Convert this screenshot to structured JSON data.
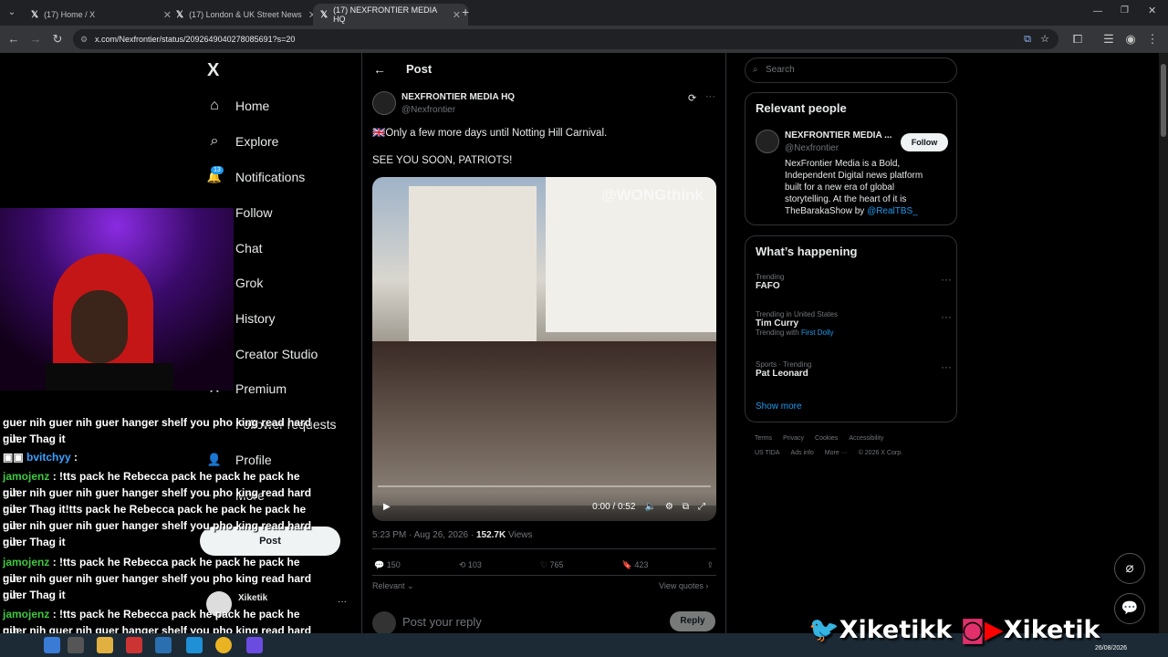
{
  "browser": {
    "tabs": [
      {
        "title": "(17) Home / X",
        "active": false
      },
      {
        "title": "(17) London & UK Street News",
        "active": false
      },
      {
        "title": "(17) NEXFRONTIER MEDIA HQ",
        "active": true
      }
    ],
    "new_tab": "+",
    "url": "x.com/Nexfrontier/status/2092649040278085691?s=20"
  },
  "sidebar": {
    "logo": "X",
    "items": [
      {
        "label": "Home",
        "icon": "home-icon",
        "glyph": "⌂"
      },
      {
        "label": "Explore",
        "icon": "search-icon",
        "glyph": "⌕"
      },
      {
        "label": "Notifications",
        "icon": "bell-icon",
        "glyph": "🔔",
        "badge": "13"
      },
      {
        "label": "Follow",
        "icon": "person-plus-icon",
        "glyph": "👤"
      },
      {
        "label": "Chat",
        "icon": "mail-icon",
        "glyph": "✉"
      },
      {
        "label": "Grok",
        "icon": "grok-icon",
        "glyph": "◪"
      },
      {
        "label": "History",
        "icon": "history-icon",
        "glyph": "🕘"
      },
      {
        "label": "Creator Studio",
        "icon": "chart-icon",
        "glyph": "▤"
      },
      {
        "label": "Premium",
        "icon": "x-premium-icon",
        "glyph": "✕"
      },
      {
        "label": "Follower requests",
        "icon": "person-icon",
        "glyph": "👤"
      },
      {
        "label": "Profile",
        "icon": "person-icon",
        "glyph": "👤"
      },
      {
        "label": "More",
        "icon": "more-circle-icon",
        "glyph": "⋯"
      }
    ],
    "post_button": "Post",
    "account_name": "Xiketik",
    "account_more": "···"
  },
  "chat": [
    {
      "user": "",
      "text": "guer nih guer nih guer hanger shelf you pho king read hard nih"
    },
    {
      "user": "",
      "text": "guer Thag it"
    },
    {
      "user": "bvitchyy",
      "text": ":"
    },
    {
      "user": "jamojenz",
      "text": ": !tts pack he Rebecca pack he pack he pack he nih"
    },
    {
      "user": "",
      "text": "guer nih guer nih guer hanger shelf you pho king read hard nih"
    },
    {
      "user": "",
      "text": "guer Thag it!tts pack he Rebecca pack he pack he pack he nih"
    },
    {
      "user": "",
      "text": "guer nih guer nih guer hanger shelf you pho king read hard nih"
    },
    {
      "user": "",
      "text": "guer Thag it"
    },
    {
      "user": "jamojenz",
      "text": ": !tts pack he Rebecca pack he pack he pack he nih"
    },
    {
      "user": "",
      "text": "guer nih guer nih guer hanger shelf you pho king read hard nih"
    },
    {
      "user": "",
      "text": "guer Thag it"
    },
    {
      "user": "jamojenz",
      "text": ": !tts pack he Rebecca pack he pack he pack he nih"
    },
    {
      "user": "",
      "text": "guer nih guer nih guer hanger shelf you pho king read hard nih"
    },
    {
      "user": "",
      "text": "guer Thag it"
    }
  ],
  "post": {
    "header_title": "Post",
    "author_name": "NEXFRONTIER MEDIA HQ",
    "author_handle": "@Nexfrontier",
    "text_line1": "🇬🇧Only a few more days until Notting Hill Carnival.",
    "text_line2": "SEE YOU SOON, PATRIOTS!",
    "video_watermark": "@WONGthink",
    "video_time": "0:00 / 0:52",
    "timestamp": "5:23 PM · Aug 26, 2026 · ",
    "views_count": "152.7K",
    "views_label": " Views",
    "replies": "150",
    "reposts": "103",
    "likes": "765",
    "bookmarks": "423",
    "relevant": "Relevant ⌄",
    "view_quotes": "View quotes ›",
    "reply_placeholder": "Post your reply",
    "reply_button": "Reply"
  },
  "right": {
    "search_placeholder": "Search",
    "relevant_title": "Relevant people",
    "person_name": "NEXFRONTIER MEDIA ...",
    "person_handle": "@Nexfrontier",
    "follow_label": "Follow",
    "bio_lines": [
      "NexFrontier Media is a Bold,",
      "Independent Digital news platform",
      "built for a new era of global",
      "storytelling. At the heart of it is"
    ],
    "bio_last": "TheBarakaShow by ",
    "bio_link": "@RealTBS_",
    "happening_title": "What’s happening",
    "trends": [
      {
        "context": "Trending",
        "name": "FAFO",
        "extra": "",
        "extra_link": ""
      },
      {
        "context": "Trending in United States",
        "name": "Tim Curry",
        "extra": "Trending with ",
        "extra_link": "First Dolly"
      },
      {
        "context": "Sports · Trending",
        "name": "Pat Leonard",
        "extra": "",
        "extra_link": ""
      }
    ],
    "show_more": "Show more",
    "footer_line1": [
      "Terms",
      "Privacy",
      "Cookies",
      "Accessibility"
    ],
    "footer_line2": [
      "US TIDA",
      "Ads info",
      "More ···",
      "© 2026 X Corp."
    ]
  },
  "overlay": {
    "brand_text": "Xiketikk",
    "brand_text2": "Xiketik"
  },
  "taskbar": {
    "time": "",
    "date": "26/08/2026"
  },
  "colors": {
    "accent": "#1d9bf0",
    "badge": "#1d9bf0",
    "chat_user": "#3ec83e"
  }
}
